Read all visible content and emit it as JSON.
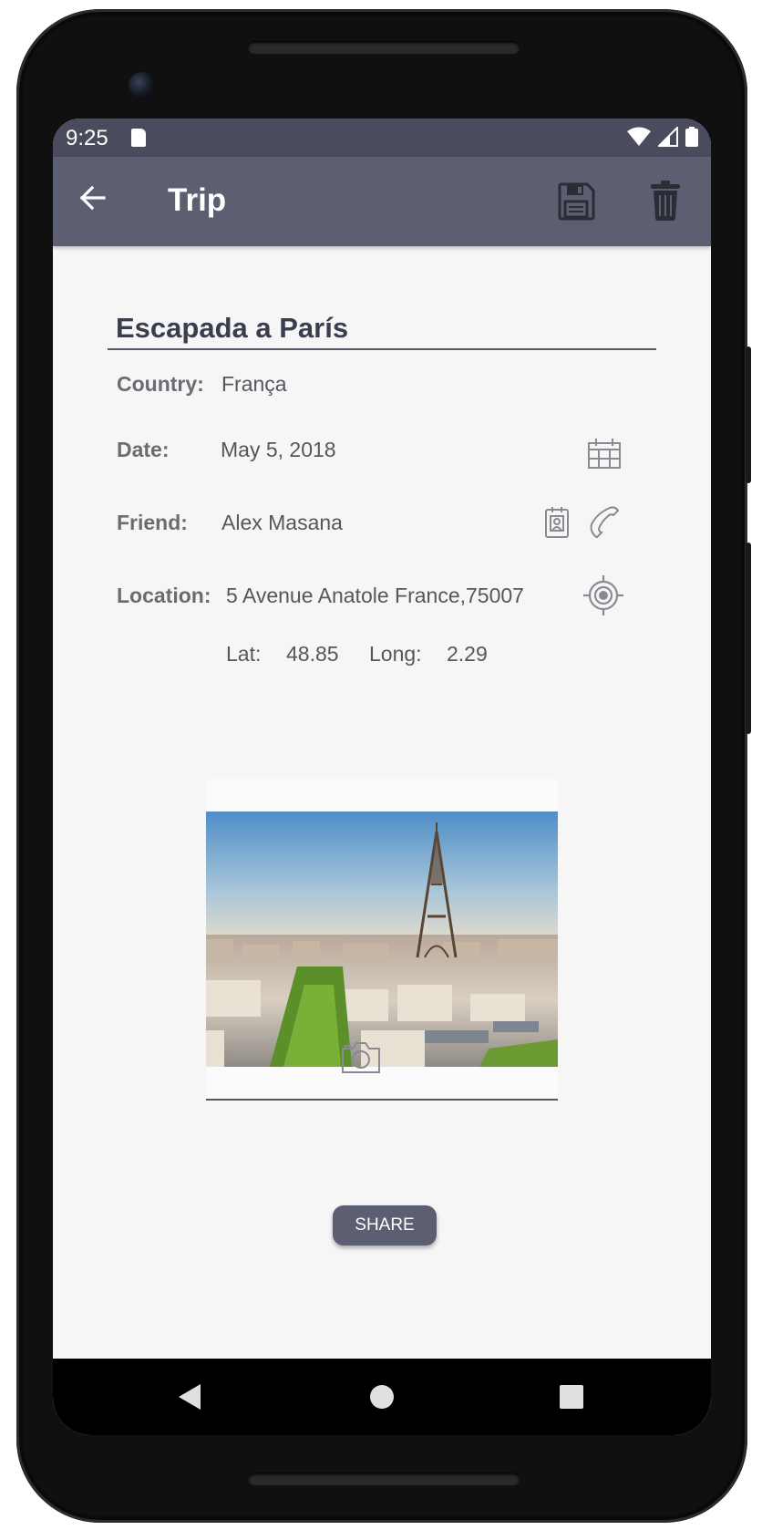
{
  "status_bar": {
    "time": "9:25"
  },
  "app_bar": {
    "title": "Trip",
    "back_icon": "arrow-left-icon",
    "save_icon": "floppy-disk-icon",
    "delete_icon": "trash-icon"
  },
  "trip": {
    "name": "Escapada a París",
    "country_label": "Country:",
    "country_value": "França",
    "date_label": "Date:",
    "date_value": "May 5, 2018",
    "friend_label": "Friend:",
    "friend_value": "Alex Masana",
    "location_label": "Location:",
    "location_value": "5 Avenue Anatole France,75007",
    "lat_label": "Lat:",
    "lat_value": "48.85",
    "long_label": "Long:",
    "long_value": "2.29"
  },
  "icons": {
    "calendar": "calendar-icon",
    "contacts": "contact-book-icon",
    "phone": "phone-icon",
    "location": "gps-target-icon",
    "camera": "camera-icon"
  },
  "photo": {
    "subject": "eiffel-tower-photo"
  },
  "actions": {
    "share_label": "SHARE"
  },
  "colors": {
    "status_bar": "#4a4b5d",
    "app_bar": "#5c5e72",
    "background": "#f6f6f7",
    "button": "#5c5e72"
  }
}
